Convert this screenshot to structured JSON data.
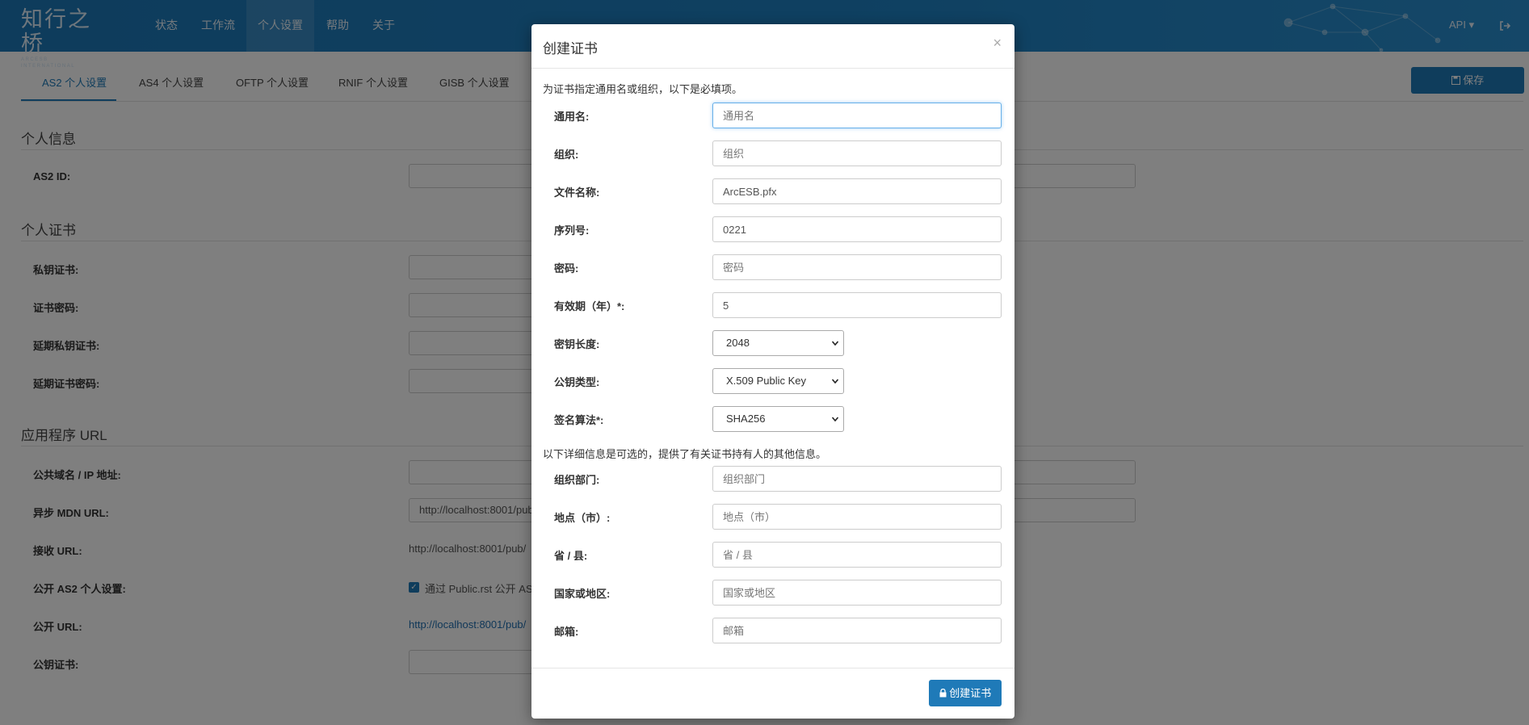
{
  "app": {
    "brand_cn": "知行之桥",
    "brand_en": "ARCESB INTERNATIONAL"
  },
  "nav": {
    "items": [
      {
        "label": "状态"
      },
      {
        "label": "工作流"
      },
      {
        "label": "个人设置",
        "active": true
      },
      {
        "label": "帮助"
      },
      {
        "label": "关于"
      }
    ],
    "api_label": "API ▾",
    "logout_icon": "sign-out-icon"
  },
  "tabs": [
    {
      "label": "AS2 个人设置",
      "active": true
    },
    {
      "label": "AS4 个人设置"
    },
    {
      "label": "OFTP 个人设置"
    },
    {
      "label": "RNIF 个人设置"
    },
    {
      "label": "GISB 个人设置"
    }
  ],
  "save_button": {
    "label": "保存",
    "icon": "floppy-icon"
  },
  "sections": {
    "personal_info": {
      "title": "个人信息",
      "as2_id_label": "AS2 ID:"
    },
    "personal_cert": {
      "title": "个人证书",
      "private_cert_label": "私钥证书:",
      "cert_password_label": "证书密码:",
      "ext_private_cert_label": "延期私钥证书:",
      "ext_cert_password_label": "延期证书密码:"
    },
    "app_url": {
      "title": "应用程序 URL",
      "public_domain_label": "公共域名 / IP 地址:",
      "async_mdn_label": "异步 MDN URL:",
      "async_mdn_value": "http://localhost:8001/pub/",
      "receive_url_label": "接收 URL:",
      "receive_url_value": "http://localhost:8001/pub/",
      "public_as2_label": "公开 AS2 个人设置:",
      "public_as2_checkbox": "通过 Public.rst 公开 AS2",
      "public_url_label": "公开 URL:",
      "public_url_value": "http://localhost:8001/pub/",
      "public_cert_label": "公钥证书:"
    }
  },
  "modal": {
    "title": "创建证书",
    "close": "×",
    "required_note": "为证书指定通用名或组织，以下是必填项。",
    "optional_note": "以下详细信息是可选的，提供了有关证书持有人的其他信息。",
    "fields": {
      "common_name": {
        "label": "通用名:",
        "placeholder": "通用名",
        "value": ""
      },
      "organization": {
        "label": "组织:",
        "placeholder": "组织",
        "value": ""
      },
      "filename": {
        "label": "文件名称:",
        "value": "ArcESB.pfx"
      },
      "serial": {
        "label": "序列号:",
        "value": "0221"
      },
      "password": {
        "label": "密码:",
        "placeholder": "密码",
        "value": ""
      },
      "validity": {
        "label": "有效期（年）*:",
        "value": "5"
      },
      "key_length": {
        "label": "密钥长度:",
        "value": "2048"
      },
      "public_key_type": {
        "label": "公钥类型:",
        "value": "X.509 Public Key"
      },
      "signature_alg": {
        "label": "签名算法*:",
        "value": "SHA256"
      },
      "org_unit": {
        "label": "组织部门:",
        "placeholder": "组织部门"
      },
      "locality": {
        "label": "地点（市）:",
        "placeholder": "地点（市）"
      },
      "state": {
        "label": "省 / 县:",
        "placeholder": "省 / 县"
      },
      "country": {
        "label": "国家或地区:",
        "placeholder": "国家或地区"
      },
      "email": {
        "label": "邮箱:",
        "placeholder": "邮箱"
      }
    },
    "create_button": {
      "label": "创建证书",
      "icon": "lock-icon"
    }
  },
  "colors": {
    "primary": "#1f7ab8",
    "navbar": "#1d78b8",
    "overlay": "rgba(0,0,0,0.5)"
  }
}
